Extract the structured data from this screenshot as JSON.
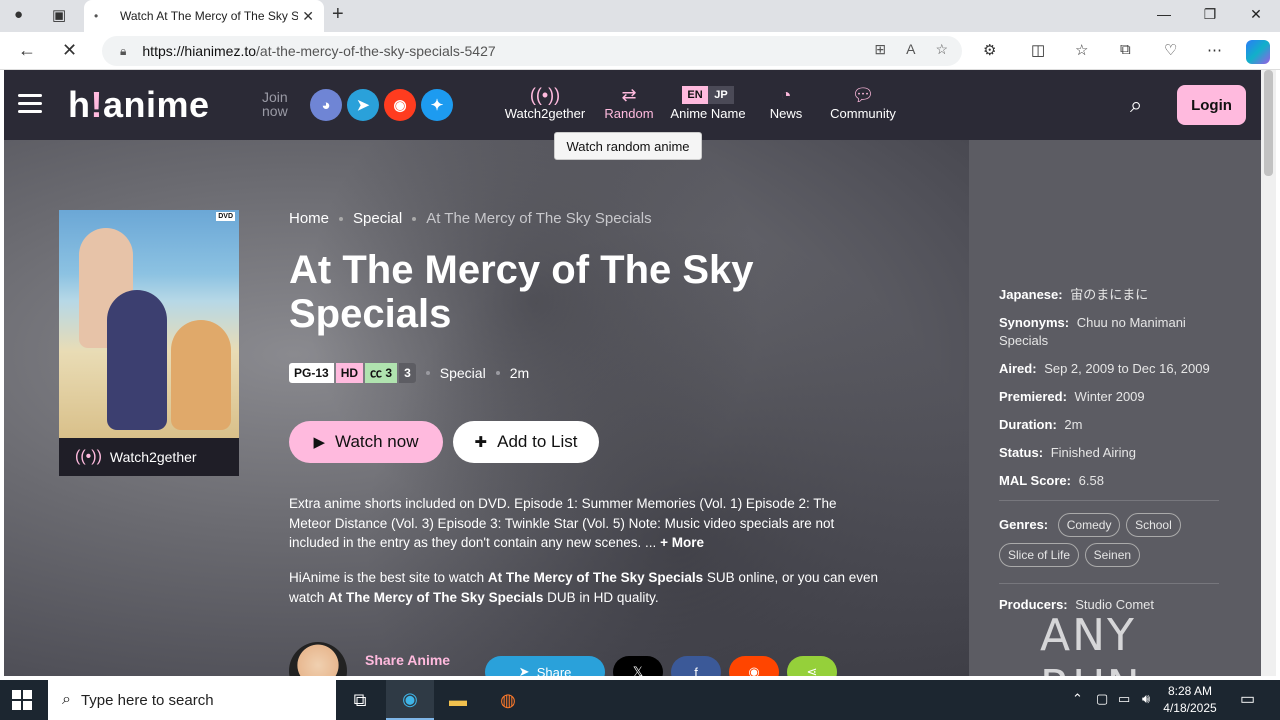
{
  "browser": {
    "tab_title": "Watch At The Mercy of The Sky S",
    "url_host": "https://hianimez.to",
    "url_path": "/at-the-mercy-of-the-sky-specials-5427"
  },
  "header": {
    "logo_main": "h",
    "logo_accent": "!",
    "logo_rest": "anime",
    "join_line1": "Join",
    "join_line2": "now",
    "nav": {
      "watch2gether": "Watch2gether",
      "random": "Random",
      "anime_name": "Anime Name",
      "lang_en": "EN",
      "lang_jp": "JP",
      "news": "News",
      "community": "Community"
    },
    "login": "Login",
    "tooltip": "Watch random anime"
  },
  "poster": {
    "watch2gether": "Watch2gether",
    "dvd": "DVD"
  },
  "breadcrumb": {
    "home": "Home",
    "type": "Special",
    "current": "At The Mercy of The Sky Specials"
  },
  "anime": {
    "title": "At The Mercy of The Sky Specials",
    "rating": "PG-13",
    "quality": "HD",
    "sub_count": "3",
    "ep_count": "3",
    "type": "Special",
    "duration": "2m",
    "watch_now": "Watch now",
    "add_to_list": "Add to List",
    "description": "Extra anime shorts included on DVD. Episode 1: Summer Memories (Vol. 1) Episode 2: The Meteor Distance (Vol. 3) Episode 3: Twinkle Star (Vol. 5) Note: Music video specials are not included in the entry as they don't contain any new scenes. ...",
    "more": "+ More",
    "seo_1": "HiAnime is the best site to watch ",
    "seo_title_1": "At The Mercy of The Sky Specials",
    "seo_2": " SUB online, or you can even watch ",
    "seo_title_2": "At The Mercy of The Sky Specials",
    "seo_3": " DUB in HD quality."
  },
  "share": {
    "label": "Share Anime",
    "share_btn": "Share"
  },
  "info": {
    "japanese_k": "Japanese:",
    "japanese_v": "宙のまにまに",
    "synonyms_k": "Synonyms:",
    "synonyms_v": "Chuu no Manimani Specials",
    "aired_k": "Aired:",
    "aired_v": "Sep 2, 2009 to Dec 16, 2009",
    "premiered_k": "Premiered:",
    "premiered_v": "Winter 2009",
    "duration_k": "Duration:",
    "duration_v": "2m",
    "status_k": "Status:",
    "status_v": "Finished Airing",
    "mal_k": "MAL Score:",
    "mal_v": "6.58",
    "genres_k": "Genres:",
    "genres": [
      "Comedy",
      "School",
      "Slice of Life",
      "Seinen"
    ],
    "producers_k": "Producers:",
    "producers_v": "Studio Comet"
  },
  "watermark": "ANY RUN",
  "taskbar": {
    "search_placeholder": "Type here to search",
    "time": "8:28 AM",
    "date": "4/18/2025"
  },
  "colors": {
    "accent": "#ffbade",
    "header_bg": "#2b2a36"
  }
}
